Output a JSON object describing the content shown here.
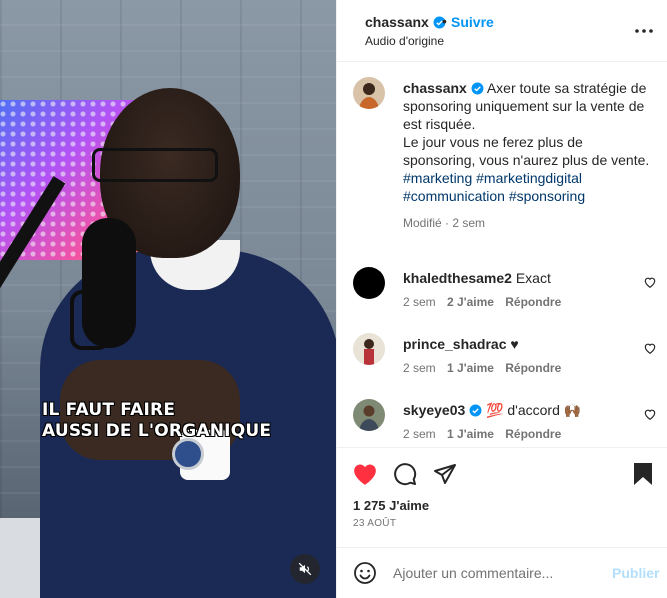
{
  "media": {
    "caption_line1": "IL FAUT FAIRE",
    "caption_line2": "AUSSI DE L'ORGANIQUE",
    "mute_icon": "speaker-muted-icon"
  },
  "header": {
    "username": "chassanx",
    "verified": true,
    "separator": "•",
    "follow_label": "Suivre",
    "audio_label": "Audio d'origine",
    "more_icon": "more-horizontal-icon"
  },
  "post": {
    "username": "chassanx",
    "text_line1": "Axer toute sa stratégie de sponsoring uniquement sur la vente de est risquée.",
    "text_line2": "Le jour vous ne ferez plus de sponsoring, vous n'aurez plus de vente.",
    "hashtags": "#marketing #marketingdigital #communication #sponsoring",
    "meta": "Modifié · 2 sem"
  },
  "comments": [
    {
      "username": "khaledthesame2",
      "text": "Exact",
      "time": "2 sem",
      "likes": "2 J'aime",
      "reply": "Répondre",
      "verified": false
    },
    {
      "username": "prince_shadrac",
      "text": "♥",
      "time": "2 sem",
      "likes": "1 J'aime",
      "reply": "Répondre",
      "verified": false
    },
    {
      "username": "skyeye03",
      "text": "💯 d'accord 🙌🏾",
      "time": "2 sem",
      "likes": "1 J'aime",
      "reply": "Répondre",
      "verified": true
    }
  ],
  "actions": {
    "like_icon": "heart-filled-icon",
    "comment_icon": "comment-icon",
    "share_icon": "paper-plane-icon",
    "save_icon": "bookmark-filled-icon",
    "likes_count": "1 275 J'aime",
    "date": "23 AOÛT"
  },
  "composer": {
    "placeholder": "Ajouter un commentaire...",
    "publish_label": "Publier",
    "emoji_icon": "emoji-icon"
  },
  "colors": {
    "link_blue": "#0095f6",
    "hashtag": "#00376b",
    "like_red": "#ff3040",
    "publish_disabled": "#b2dffc",
    "muted_text": "#737373"
  }
}
